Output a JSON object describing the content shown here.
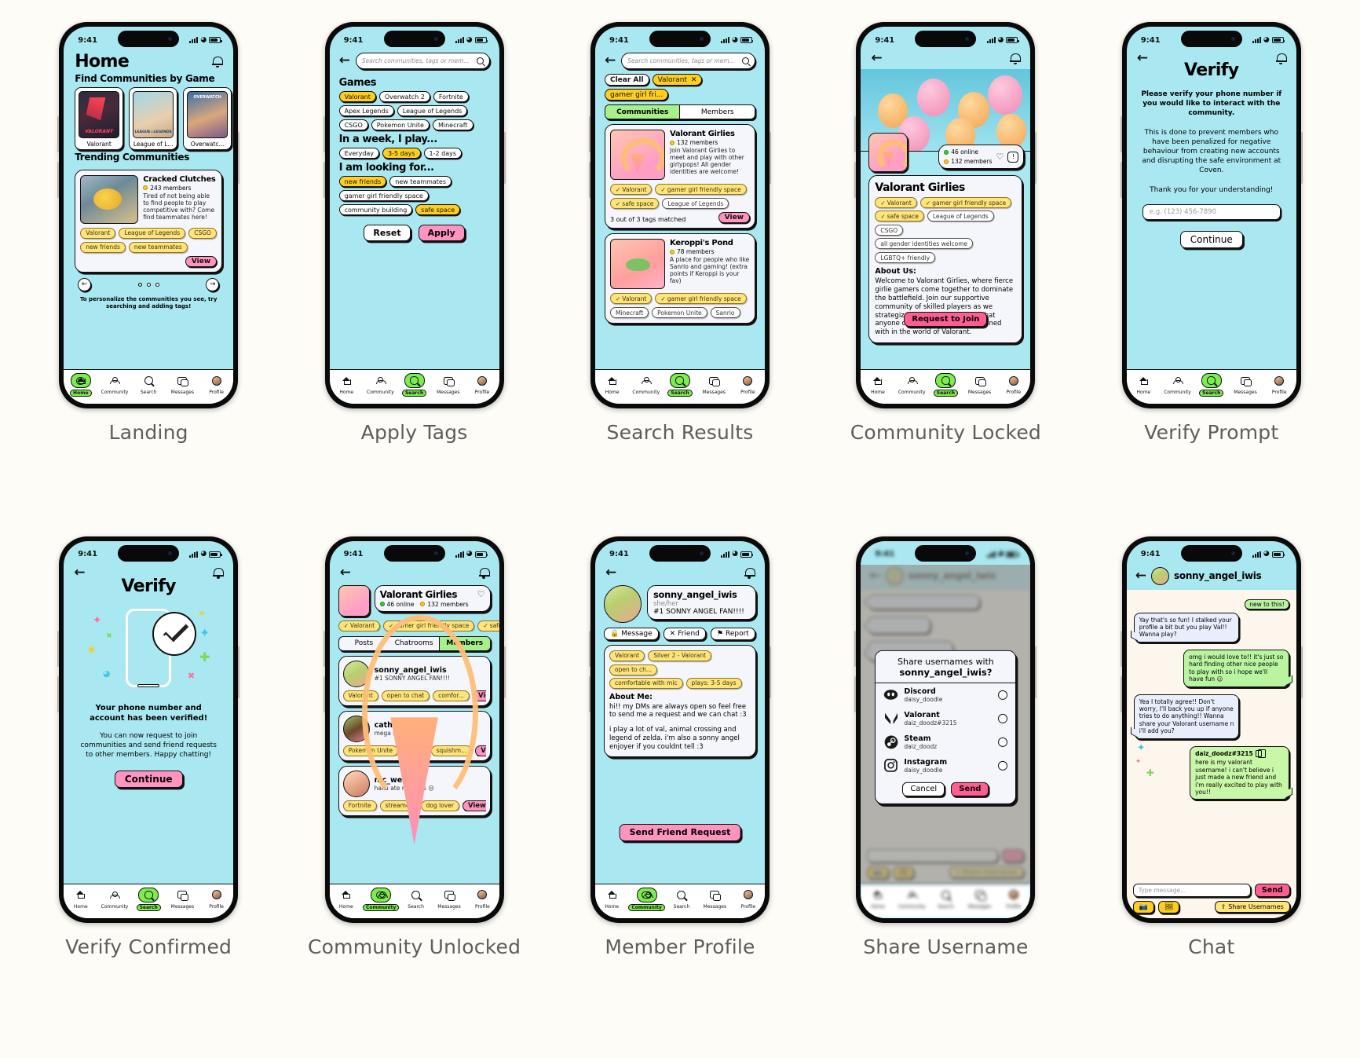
{
  "status_bar": {
    "time": "9:41"
  },
  "screens": [
    {
      "caption": "Landing",
      "title": "Home",
      "section_games": "Find Communities by Game",
      "games": [
        {
          "name": "Valorant"
        },
        {
          "name": "League of L..."
        },
        {
          "name": "Overwatc..."
        }
      ],
      "section_trending": "Trending Communities",
      "trending": {
        "name": "Cracked Clutches",
        "members": "243 members",
        "desc": "Tired of not being able to find people to play competitive with? Come find teammates here!",
        "tags": [
          "Valorant",
          "League of Legends",
          "CSGO",
          "new friends",
          "new teammates"
        ],
        "view": "View"
      },
      "hint": "To personalize the communities you see, try searching and adding tags!"
    },
    {
      "caption": "Apply Tags",
      "search_placeholder": "Search communities, tags or mem...",
      "groups": [
        {
          "heading": "Games",
          "tags": [
            {
              "label": "Valorant",
              "selected": true
            },
            {
              "label": "Overwatch 2",
              "selected": false
            },
            {
              "label": "Fortnite",
              "selected": false
            },
            {
              "label": "Apex Legends",
              "selected": false
            },
            {
              "label": "League of Legends",
              "selected": false
            },
            {
              "label": "CSGO",
              "selected": false
            },
            {
              "label": "Pokemon Unite",
              "selected": false
            },
            {
              "label": "Minecraft",
              "selected": false
            }
          ]
        },
        {
          "heading": "In a week, I play...",
          "tags": [
            {
              "label": "Everyday",
              "selected": false
            },
            {
              "label": "3-5 days",
              "selected": true
            },
            {
              "label": "1-2 days",
              "selected": false
            }
          ]
        },
        {
          "heading": "I am looking for...",
          "tags": [
            {
              "label": "new friends",
              "selected": true
            },
            {
              "label": "new teammates",
              "selected": false
            },
            {
              "label": "gamer girl friendly space",
              "selected": false
            },
            {
              "label": "community building",
              "selected": false
            },
            {
              "label": "safe space",
              "selected": true
            }
          ]
        }
      ],
      "reset": "Reset",
      "apply": "Apply"
    },
    {
      "caption": "Search Results",
      "search_placeholder": "Search communities, tags or mem...",
      "clear_all": "Clear All",
      "active_filters": [
        "Valorant",
        "gamer girl fri..."
      ],
      "tabs": [
        {
          "label": "Communities",
          "active": true
        },
        {
          "label": "Members",
          "active": false
        }
      ],
      "results": [
        {
          "name": "Valorant Girlies",
          "members": "132 members",
          "desc": "Join Valorant Girlies to meet and play with other girlypops! All gender identities are welcome!",
          "tags_checked": [
            "Valorant",
            "gamer girl friendly space",
            "safe space"
          ],
          "tags_plain": [
            "League of Legends"
          ],
          "match": "3 out of 3 tags matched",
          "view": "View"
        },
        {
          "name": "Keroppi's Pond",
          "members": "78 members",
          "desc": "A place for people who like Sanrio and gaming! (extra points if Keroppi is your fav)",
          "tags_checked": [
            "Valorant",
            "gamer girl friendly space"
          ],
          "tags_plain": [
            "Minecraft",
            "Pokemon Unite",
            "Sanrio"
          ],
          "match": "",
          "view": "View"
        }
      ]
    },
    {
      "caption": "Community Locked",
      "online": "46 online",
      "members": "132 members",
      "name": "Valorant Girlies",
      "tags_checked": [
        "Valorant",
        "gamer girl friendly space",
        "safe space"
      ],
      "tags_plain": [
        "League of Legends",
        "CSGO",
        "all gender identities welcome",
        "LGBTQ+ friendly"
      ],
      "about_heading": "About Us:",
      "about_text": "Welcome to Valorant Girlies, where fierce girlie gamers come together to dominate the battlefield. Join our supportive community of skilled players as we strategize, aim high, and prove that anyone can be a force to be reckoned with in the world of Valorant.",
      "request_button": "Request to Join"
    },
    {
      "caption": "Verify Prompt",
      "title": "Verify",
      "line1": "Please verify your phone number if you would like to interact with the community.",
      "line2": "This is done to prevent members who have been penalized for negative behaviour from creating new accounts and disrupting the safe environment at Coven.",
      "line3": "Thank you for your understanding!",
      "input_placeholder": "e.g. (123) 456-7890",
      "continue": "Continue"
    },
    {
      "caption": "Verify Confirmed",
      "title": "Verify",
      "headline": "Your phone number and account has been verified!",
      "body": "You can now request to join communities and send friend requests to other members. Happy chatting!",
      "continue": "Continue"
    },
    {
      "caption": "Community Unlocked",
      "name": "Valorant Girlies",
      "online": "46 online",
      "members": "132 members",
      "tags_checked": [
        "Valorant",
        "gamer girl friendly space",
        "safe"
      ],
      "tabs": [
        {
          "label": "Posts",
          "active": false
        },
        {
          "label": "Chatrooms",
          "active": false
        },
        {
          "label": "Members",
          "active": true
        }
      ],
      "members_list": [
        {
          "name": "sonny_angel_iwis",
          "sub": "#1 SONNY ANGEL FAN!!!!",
          "tags": [
            "Valorant",
            "open to chat",
            "comfor..."
          ],
          "view": "View"
        },
        {
          "name": "cathiuwu",
          "sub": "mega slowbro",
          "tags": [
            "Pokemon Unite",
            "artist",
            "squishm..."
          ],
          "view": "View"
        },
        {
          "name": "nic_weeee",
          "sub": "haku ate my keys ☹",
          "tags": [
            "Fortnite",
            "streamer",
            "dog lover"
          ],
          "view": "View"
        }
      ]
    },
    {
      "caption": "Member Profile",
      "name": "sonny_angel_iwis",
      "pronouns": "she/her",
      "bio": "#1 SONNY ANGEL FAN!!!!",
      "actions": [
        {
          "label": "Message",
          "icon": "lock-icon"
        },
        {
          "label": "Friend",
          "icon": "x-icon"
        },
        {
          "label": "Report",
          "icon": "flag-icon"
        }
      ],
      "tags": [
        "Valorant",
        "Silver 2 - Valorant",
        "open to ch...",
        "comfortable with mic",
        "plays: 3-5 days"
      ],
      "about_heading": "About Me:",
      "about_p1": "hi!! my DMs are always open so feel free to send me a request and we can chat :3",
      "about_p2": "i play a lot of val, animal crossing and legend of zelda. i'm also a sonny angel enjoyer if you couldnt tell :3",
      "send_request": "Send Friend Request"
    },
    {
      "caption": "Share Username",
      "chat_name": "sonny_angel_iwis",
      "modal_line1": "Share usernames with",
      "modal_line2": "sonny_angel_iwis?",
      "options": [
        {
          "platform": "Discord",
          "handle": "daisy_doodle",
          "icon": "discord-icon"
        },
        {
          "platform": "Valorant",
          "handle": "daiz_doodz#3215",
          "icon": "valorant-icon"
        },
        {
          "platform": "Steam",
          "handle": "daiz_doodz",
          "icon": "steam-icon"
        },
        {
          "platform": "Instagram",
          "handle": "daisy_doodle",
          "icon": "instagram-icon"
        }
      ],
      "cancel": "Cancel",
      "send": "Send"
    },
    {
      "caption": "Chat",
      "name": "sonny_angel_iwis",
      "new_chip": "new to this!",
      "messages": [
        {
          "from": "them",
          "text": "Yay that's so fun! I stalked your profile a bit but you play Val!! Wanna play?"
        },
        {
          "from": "me",
          "text": "omg i would love to!! it's just so hard finding other nice people to play with so i hope we'll have fun ☺"
        },
        {
          "from": "them",
          "text": "Yea I totally agree!! Don't worry, I'll back you up if anyone tries to do anything!! Wanna share your Valorant username n i'll add you?"
        },
        {
          "from": "me",
          "header": "daiz_doodz#3215",
          "text": "here is my valorant username! i can't believe i just made a new friend and i'm really excited to play with you!!"
        }
      ],
      "input_placeholder": "Type message...",
      "send": "Send",
      "share_usernames": "Share Usernames"
    }
  ],
  "tabbar": {
    "items": [
      {
        "label": "Home",
        "icon": "home-icon"
      },
      {
        "label": "Community",
        "icon": "community-icon"
      },
      {
        "label": "Search",
        "icon": "search-icon"
      },
      {
        "label": "Messages",
        "icon": "messages-icon"
      },
      {
        "label": "Profile",
        "icon": "profile-icon"
      }
    ]
  },
  "colors": {
    "bg": "#a9e8f0",
    "accent_yellow": "#ffce1f",
    "accent_pink": "#ff5e93",
    "accent_green": "#7ced4e"
  }
}
